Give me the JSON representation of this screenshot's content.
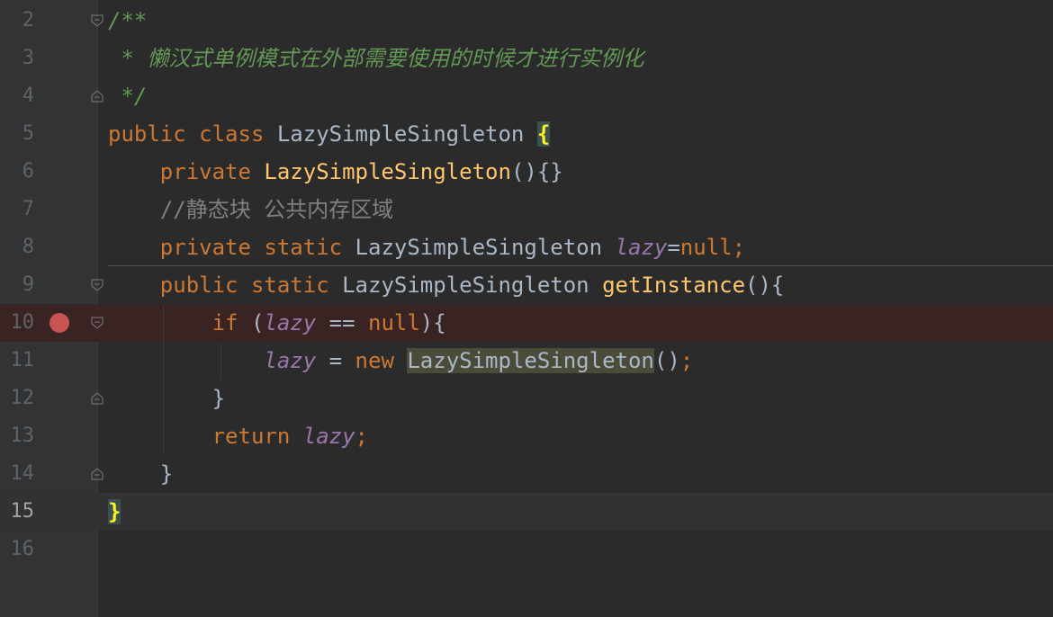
{
  "editor": {
    "lines": [
      {
        "num": "2",
        "tokens": [
          {
            "t": "/**",
            "c": "doc"
          }
        ],
        "fold": "start"
      },
      {
        "num": "3",
        "tokens": [
          {
            "t": " * 懒汉式单例模式在外部需要使用的时候才进行实例化",
            "c": "doc"
          }
        ]
      },
      {
        "num": "4",
        "tokens": [
          {
            "t": " */",
            "c": "doc"
          }
        ],
        "fold": "end"
      },
      {
        "num": "5",
        "tokens": [
          {
            "t": "public class ",
            "c": "kw"
          },
          {
            "t": "LazySimpleSingleton ",
            "c": "cls"
          },
          {
            "t": "{",
            "c": "brace-hl"
          }
        ]
      },
      {
        "num": "6",
        "tokens": [
          {
            "t": "    private ",
            "c": "kw"
          },
          {
            "t": "LazySimpleSingleton",
            "c": "fn"
          },
          {
            "t": "(){}",
            "c": "cls"
          }
        ]
      },
      {
        "num": "7",
        "tokens": [
          {
            "t": "    //静态块 公共内存区域",
            "c": "cmt"
          }
        ]
      },
      {
        "num": "8",
        "tokens": [
          {
            "t": "    private static ",
            "c": "kw"
          },
          {
            "t": "LazySimpleSingleton ",
            "c": "cls"
          },
          {
            "t": "lazy",
            "c": "var"
          },
          {
            "t": "=",
            "c": "cls"
          },
          {
            "t": "null;",
            "c": "kw"
          }
        ]
      },
      {
        "num": "9",
        "tokens": [
          {
            "t": "    public static ",
            "c": "kw"
          },
          {
            "t": "LazySimpleSingleton ",
            "c": "cls"
          },
          {
            "t": "getInstance",
            "c": "fn"
          },
          {
            "t": "(){",
            "c": "cls"
          }
        ],
        "fold": "start"
      },
      {
        "num": "10",
        "tokens": [
          {
            "t": "        if ",
            "c": "kw"
          },
          {
            "t": "(",
            "c": "cls"
          },
          {
            "t": "lazy",
            "c": "var"
          },
          {
            "t": " == ",
            "c": "cls"
          },
          {
            "t": "null",
            "c": "kw"
          },
          {
            "t": "){",
            "c": "cls"
          }
        ],
        "fold": "start",
        "breakpoint": true
      },
      {
        "num": "11",
        "tokens": [
          {
            "t": "            ",
            "c": "cls"
          },
          {
            "t": "lazy",
            "c": "var"
          },
          {
            "t": " = ",
            "c": "cls"
          },
          {
            "t": "new ",
            "c": "kw"
          },
          {
            "t": "LazySimpleSingleton",
            "c": "usage-hl"
          },
          {
            "t": "()",
            "c": "cls"
          },
          {
            "t": ";",
            "c": "kw"
          }
        ]
      },
      {
        "num": "12",
        "tokens": [
          {
            "t": "        }",
            "c": "cls"
          }
        ],
        "fold": "end"
      },
      {
        "num": "13",
        "tokens": [
          {
            "t": "        return ",
            "c": "kw"
          },
          {
            "t": "lazy",
            "c": "var"
          },
          {
            "t": ";",
            "c": "kw"
          }
        ]
      },
      {
        "num": "14",
        "tokens": [
          {
            "t": "    }",
            "c": "cls"
          }
        ],
        "fold": "end"
      },
      {
        "num": "15",
        "tokens": [
          {
            "t": "}",
            "c": "brace-hl"
          }
        ],
        "current": true
      },
      {
        "num": "16",
        "tokens": []
      }
    ],
    "colors": {
      "background": "#2b2b2b",
      "keyword": "#cc7832",
      "doc_comment": "#629755",
      "line_comment": "#808080",
      "method_name": "#ffc66d",
      "static_field": "#9876aa",
      "breakpoint": "#c75450"
    },
    "icons": {
      "fold_start": "fold-start-icon",
      "fold_end": "fold-end-icon",
      "breakpoint": "breakpoint-icon"
    }
  }
}
